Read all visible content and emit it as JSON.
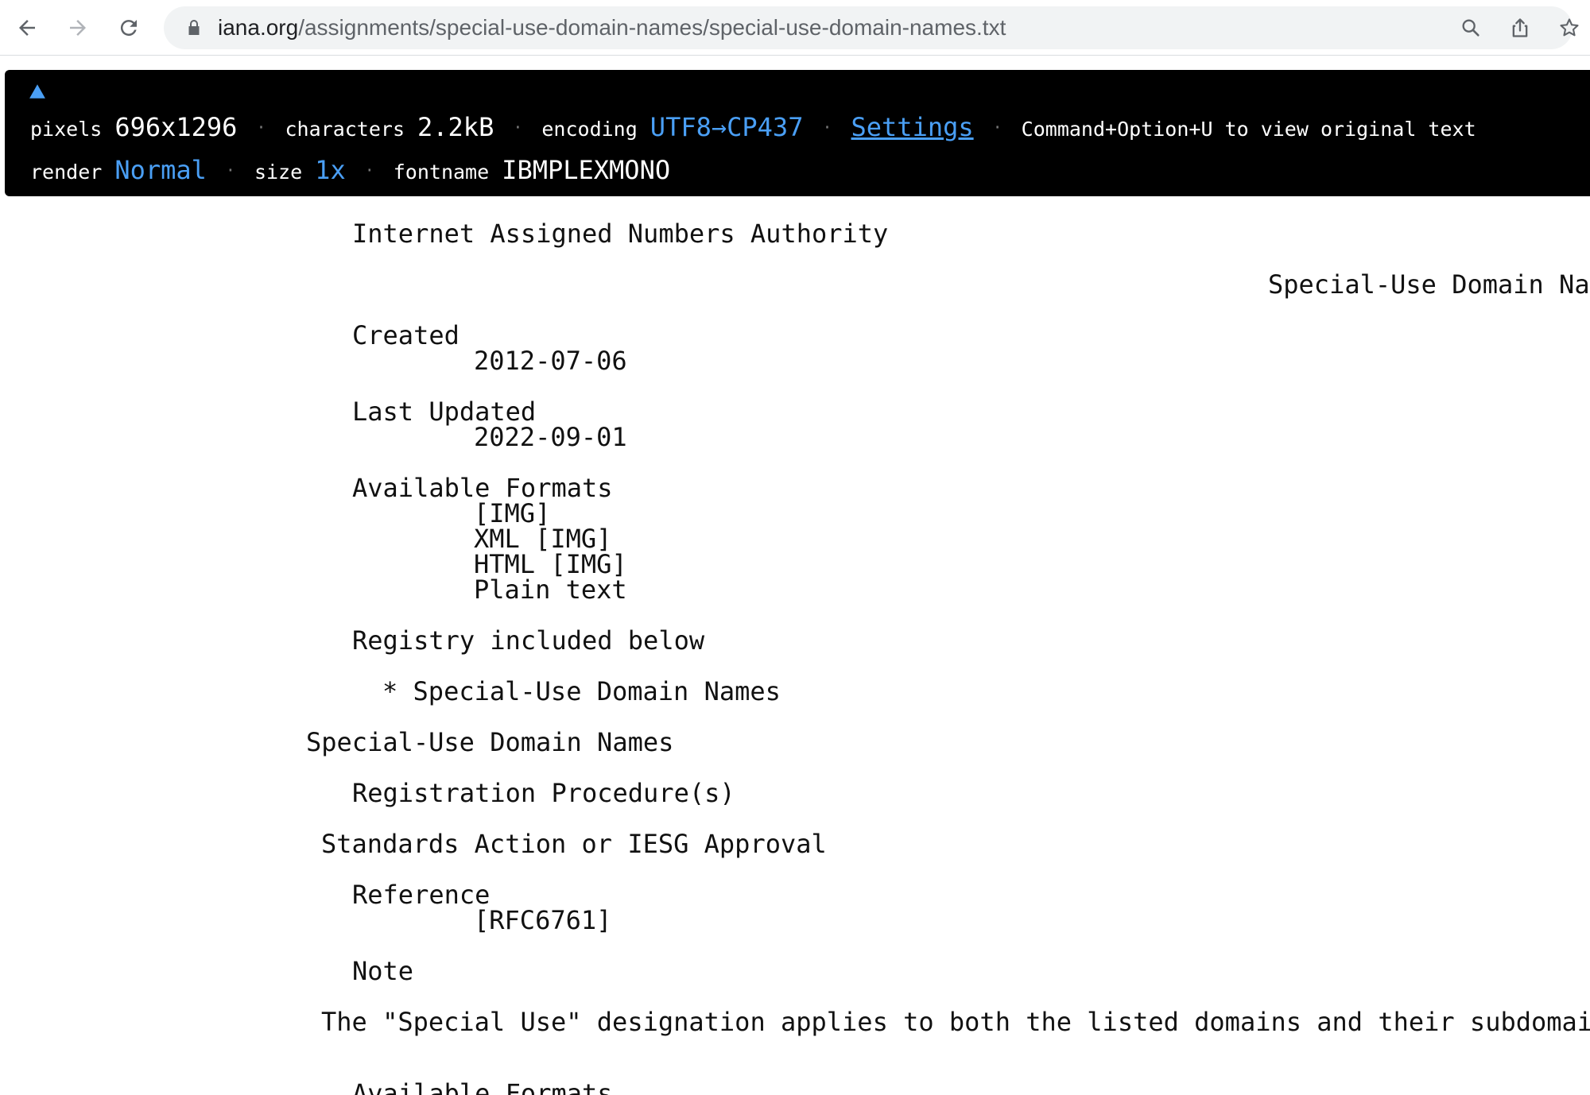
{
  "browser": {
    "url_host": "iana.org",
    "url_path": "/assignments/special-use-domain-names/special-use-domain-names.txt"
  },
  "banner": {
    "pixels_label": "pixels",
    "pixels_value": "696x1296",
    "characters_label": "characters",
    "characters_value": "2.2kB",
    "encoding_label": "encoding",
    "encoding_value": "UTF8→CP437",
    "settings_label": "Settings",
    "shortcut_hint": "Command+Option+U to view original text",
    "render_label": "render",
    "render_value": "Normal",
    "size_label": "size",
    "size_value": "1x",
    "fontname_label": "fontname",
    "fontname_value": "IBMPLEXMONO",
    "separator": "·"
  },
  "document": {
    "org": "Internet Assigned Numbers Authority",
    "doc_title": "Special-Use Domain Names",
    "created_label": "Created",
    "created_value": "2012-07-06",
    "updated_label": "Last Updated",
    "updated_value": "2022-09-01",
    "formats_label": "Available Formats",
    "formats": [
      "[IMG]",
      "XML [IMG]",
      "HTML [IMG]",
      "Plain text"
    ],
    "registry_label": "Registry included below",
    "registry_item": "* Special-Use Domain Names",
    "section_title": "Special-Use Domain Names",
    "procedure_label": "Registration Procedure(s)",
    "procedure_value": "Standards Action or IESG Approval",
    "reference_label": "Reference",
    "reference_value": "[RFC6761]",
    "note_label": "Note",
    "note_text": "The \"Special Use\" designation applies to both the listed domains and their subdomains.",
    "formats_label_2": "Available Formats"
  }
}
